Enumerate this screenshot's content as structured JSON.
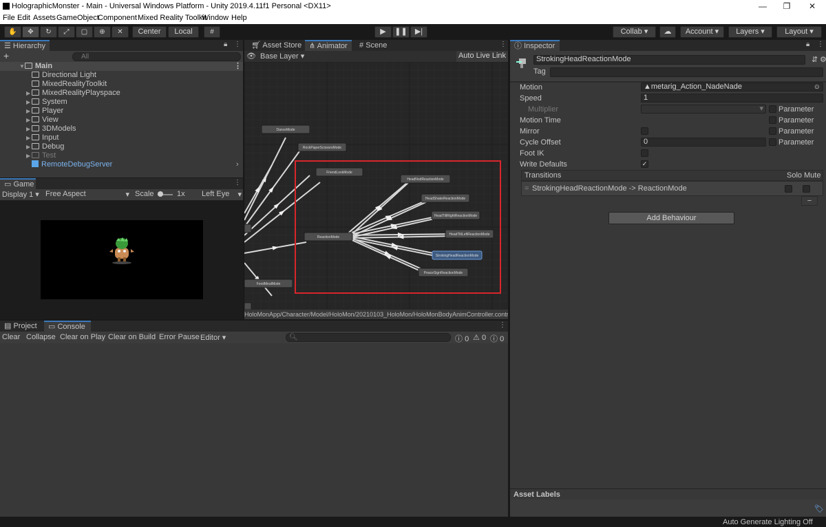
{
  "window": {
    "title": "HolographicMonster - Main - Universal Windows Platform - Unity 2019.4.11f1 Personal <DX11>"
  },
  "menu": [
    "File",
    "Edit",
    "Assets",
    "GameObject",
    "Component",
    "Mixed Reality Toolkit",
    "Window",
    "Help"
  ],
  "toolbar": {
    "center_label": "Center",
    "local_label": "Local",
    "collab_label": "Collab",
    "account_label": "Account",
    "layers_label": "Layers",
    "layout_label": "Layout"
  },
  "hierarchy": {
    "tab": "Hierarchy",
    "add": "+",
    "search_placeholder": "All",
    "scene": "Main",
    "items": [
      "Directional Light",
      "MixedRealityToolkit",
      "MixedRealityPlayspace",
      "System",
      "Player",
      "View",
      "3DModels",
      "Input",
      "Debug",
      "Test",
      "RemoteDebugServer"
    ]
  },
  "game": {
    "tab": "Game",
    "display": "Display 1",
    "aspect": "Free Aspect",
    "scale_label": "Scale",
    "scale_value": "1x",
    "eye": "Left Eye"
  },
  "animator": {
    "tabs": [
      "Asset Store",
      "Animator",
      "Scene"
    ],
    "layer": "Base Layer",
    "live_link": "Auto Live Link",
    "nodes": [
      "DanceMode",
      "RockPaperScissorsMode",
      "FriendLookMode",
      "HeadNodReactionMode",
      "HeadShakeReactionMode",
      "HeadTiltRightReactionMode",
      "HeadTiltLeftReactionMode",
      "ReactionMode",
      "StrokingHeadReactionMode",
      "PeaceSignReactionMode",
      "FoodMealMode"
    ],
    "path": "HoloMonApp/Character/Model/HoloMon/20210103_HoloMon/HoloMonBodyAnimController.controller",
    "highlight_color": "#d9262b"
  },
  "console": {
    "tabs": [
      "Project",
      "Console"
    ],
    "buttons": [
      "Clear",
      "Collapse",
      "Clear on Play",
      "Clear on Build",
      "Error Pause",
      "Editor"
    ],
    "counts": [
      "0",
      "0",
      "0"
    ]
  },
  "inspector": {
    "tab": "Inspector",
    "name": "StrokingHeadReactionMode",
    "tag_label": "Tag",
    "motion_label": "Motion",
    "motion_value": "metarig_Action_NadeNade",
    "speed_label": "Speed",
    "speed_value": "1",
    "multiplier_label": "Multiplier",
    "parameter_label": "Parameter",
    "motion_time_label": "Motion Time",
    "mirror_label": "Mirror",
    "cycle_offset_label": "Cycle Offset",
    "cycle_offset_value": "0",
    "foot_ik_label": "Foot IK",
    "write_defaults_label": "Write Defaults",
    "write_defaults_check": "✓",
    "transitions_label": "Transitions",
    "solo_label": "Solo",
    "mute_label": "Mute",
    "transition": "StrokingHeadReactionMode -> ReactionMode",
    "minus": "−",
    "add_behaviour": "Add Behaviour",
    "asset_labels": "Asset Labels"
  },
  "status": {
    "text": "Auto Generate Lighting Off"
  }
}
